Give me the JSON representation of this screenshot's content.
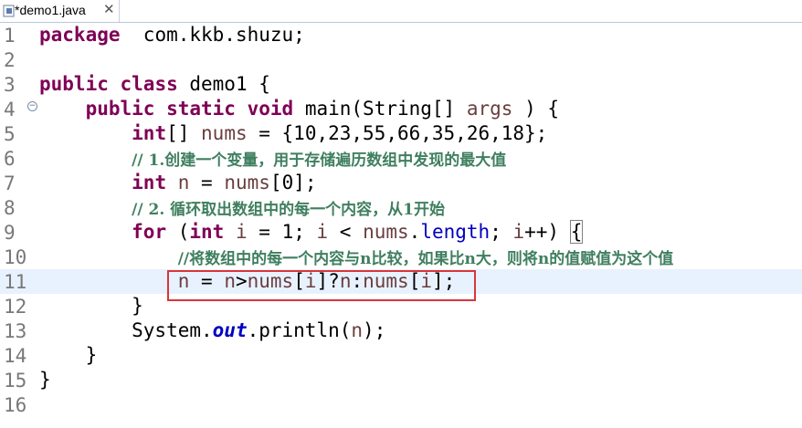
{
  "tab": {
    "title": "*demo1.java",
    "close": "✕",
    "icon": "java-file-icon"
  },
  "fold_marker": "−",
  "colors": {
    "keyword": "#7f0055",
    "comment": "#3f7f5f",
    "field": "#0000c0",
    "local_var": "#6a3e3e",
    "highlight_box": "#d9353a",
    "current_line": "#e8f2fe"
  },
  "lines": [
    {
      "n": "1",
      "tokens": [
        [
          "kw",
          "package"
        ],
        [
          "",
          "  com.kkb.shuzu;"
        ]
      ]
    },
    {
      "n": "2",
      "tokens": []
    },
    {
      "n": "3",
      "tokens": [
        [
          "kw",
          "public"
        ],
        [
          "",
          " "
        ],
        [
          "kw",
          "class"
        ],
        [
          "",
          " demo1 {"
        ]
      ]
    },
    {
      "n": "4",
      "tokens": [
        [
          "",
          "    "
        ],
        [
          "kw",
          "public"
        ],
        [
          "",
          " "
        ],
        [
          "kw",
          "static"
        ],
        [
          "",
          " "
        ],
        [
          "kw",
          "void"
        ],
        [
          "",
          " main(String[] "
        ],
        [
          "var",
          "args"
        ],
        [
          "",
          " ) {"
        ]
      ]
    },
    {
      "n": "5",
      "tokens": [
        [
          "",
          "        "
        ],
        [
          "kw",
          "int"
        ],
        [
          "",
          "[] "
        ],
        [
          "var",
          "nums"
        ],
        [
          "",
          " = {10,23,55,66,35,26,18};"
        ]
      ]
    },
    {
      "n": "6",
      "tokens": [
        [
          "",
          "        "
        ],
        [
          "cmt",
          "// 1.创建一个变量，用于存储遍历数组中发现的最大值"
        ]
      ]
    },
    {
      "n": "7",
      "tokens": [
        [
          "",
          "        "
        ],
        [
          "kw",
          "int"
        ],
        [
          "",
          " "
        ],
        [
          "var",
          "n"
        ],
        [
          "",
          " = "
        ],
        [
          "var",
          "nums"
        ],
        [
          "",
          "[0];"
        ]
      ]
    },
    {
      "n": "8",
      "tokens": [
        [
          "",
          "        "
        ],
        [
          "cmt",
          "// 2. 循环取出数组中的每一个内容，从1开始"
        ]
      ]
    },
    {
      "n": "9",
      "tokens": [
        [
          "",
          "        "
        ],
        [
          "kw",
          "for"
        ],
        [
          "",
          " ("
        ],
        [
          "kw",
          "int"
        ],
        [
          "",
          " "
        ],
        [
          "var",
          "i"
        ],
        [
          "",
          " = 1; "
        ],
        [
          "var",
          "i"
        ],
        [
          "",
          " < "
        ],
        [
          "var",
          "nums"
        ],
        [
          "",
          "."
        ],
        [
          "fld",
          "length"
        ],
        [
          "",
          "; "
        ],
        [
          "var",
          "i"
        ],
        [
          "",
          "++) "
        ],
        [
          "bracket",
          "{"
        ]
      ]
    },
    {
      "n": "10",
      "tokens": [
        [
          "",
          "            "
        ],
        [
          "cmt",
          "//将数组中的每一个内容与n比较，如果比n大，则将n的值赋值为这个值"
        ]
      ]
    },
    {
      "n": "11",
      "tokens": [
        [
          "",
          "            "
        ],
        [
          "var",
          "n"
        ],
        [
          "",
          " = "
        ],
        [
          "var",
          "n"
        ],
        [
          "",
          ">"
        ],
        [
          "var",
          "nums"
        ],
        [
          "",
          "["
        ],
        [
          "var",
          "i"
        ],
        [
          "",
          "]?"
        ],
        [
          "var",
          "n"
        ],
        [
          "",
          ":"
        ],
        [
          "var",
          "nums"
        ],
        [
          "",
          "["
        ],
        [
          "var",
          "i"
        ],
        [
          "",
          "];"
        ]
      ]
    },
    {
      "n": "12",
      "tokens": [
        [
          "",
          "        }"
        ]
      ]
    },
    {
      "n": "13",
      "tokens": [
        [
          "",
          "        System."
        ],
        [
          "stat",
          "out"
        ],
        [
          "",
          ".println("
        ],
        [
          "var",
          "n"
        ],
        [
          "",
          ");"
        ]
      ]
    },
    {
      "n": "14",
      "tokens": [
        [
          "",
          "    }"
        ]
      ]
    },
    {
      "n": "15",
      "tokens": [
        [
          "",
          "}"
        ]
      ]
    },
    {
      "n": "16",
      "tokens": []
    }
  ]
}
